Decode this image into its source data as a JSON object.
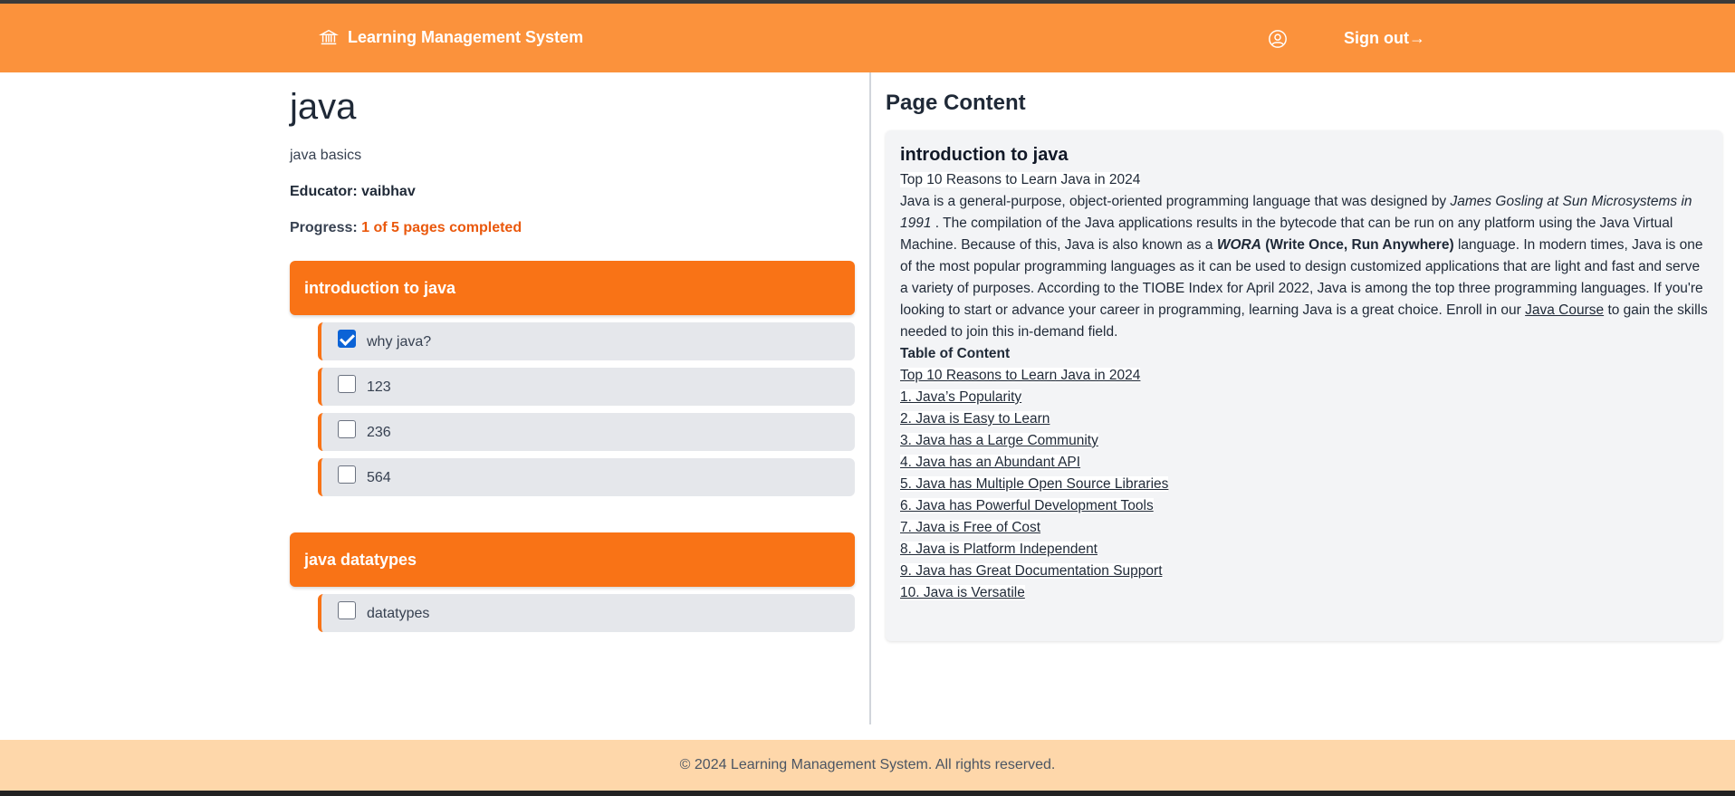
{
  "header": {
    "brand_title": "Learning Management System",
    "sign_out_label": "Sign out→"
  },
  "course": {
    "title": "java",
    "description": "java basics",
    "educator_label": "Educator:",
    "educator_name": "vaibhav",
    "progress_label": "Progress:",
    "progress_text": "1 of 5 pages completed",
    "pages_completed": 1,
    "pages_total": 5
  },
  "modules": [
    {
      "title": "introduction to java",
      "pages": [
        {
          "label": "why java?",
          "checked": true
        },
        {
          "label": "123",
          "checked": false
        },
        {
          "label": "236",
          "checked": false
        },
        {
          "label": "564",
          "checked": false
        }
      ]
    },
    {
      "title": "java datatypes",
      "pages": [
        {
          "label": "datatypes",
          "checked": false
        }
      ]
    }
  ],
  "page_content": {
    "heading": "Page Content",
    "title": "introduction to java",
    "subtitle": "Top 10 Reasons to Learn Java in 2024",
    "para_1": "Java is a general-purpose, object-oriented programming language that was designed by",
    "para_1_italic": "James Gosling at Sun Microsystems in 1991",
    "para_2": ". The compilation of the Java applications results in the bytecode that can be run on any platform using the Java Virtual Machine. Because of this, Java is also known as a",
    "para_wora": "WORA",
    "para_wora_full": "(Write Once, Run Anywhere)",
    "para_3": "language. In modern times, Java is one of the most popular programming languages as it can be used to design customized applications that are light and fast and serve a variety of purposes. According to the TIOBE Index for April 2022, Java is among the top three programming languages. If you're looking to start or advance your career in programming, learning Java is a great choice. Enroll in our",
    "para_link": "Java Course",
    "para_4": "to gain the skills needed to join this in-demand field.",
    "toc_heading": "Table of Content",
    "toc": [
      "Top 10 Reasons to Learn Java in 2024",
      "1. Java’s Popularity",
      "2. Java is Easy to Learn",
      "3. Java has a Large Community",
      "4. Java has an Abundant API",
      "5. Java has Multiple Open Source Libraries",
      "6. Java has Powerful Development Tools",
      "7. Java is Free of Cost",
      "8. Java is Platform Independent",
      "9. Java has Great Documentation Support",
      "10. Java is Versatile"
    ]
  },
  "footer": {
    "text": "© 2024 Learning Management System. All rights reserved."
  },
  "colors": {
    "header_bg": "#fb923c",
    "module_bg": "#f97316",
    "footer_bg": "#fed7aa",
    "progress_accent": "#ea580c"
  }
}
